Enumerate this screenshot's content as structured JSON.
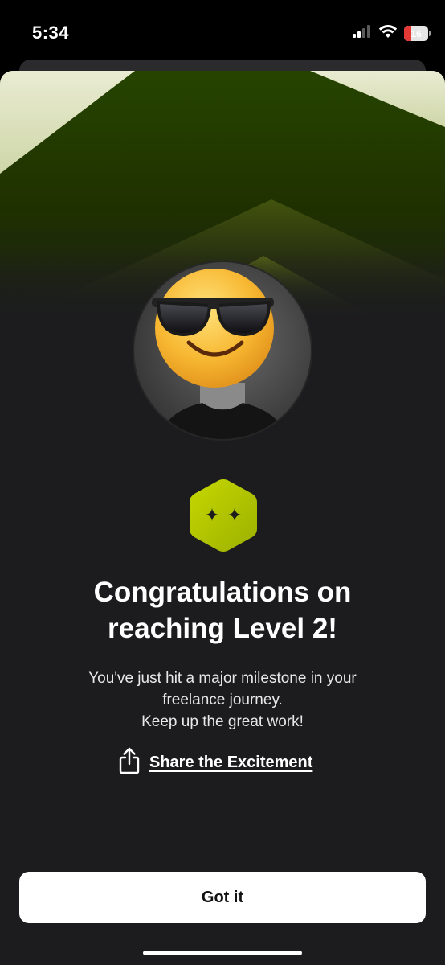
{
  "status_bar": {
    "time": "5:34",
    "battery_label": "16",
    "battery_level": 0.16,
    "icons": [
      "cellular-signal-icon",
      "wifi-icon",
      "battery-charging-icon"
    ]
  },
  "modal": {
    "avatar_icon": "profile-avatar-sunglasses-emoji",
    "badge_icon": "level-hexagon-badge-icon",
    "title_lines": [
      "Congratulations on",
      "reaching Level 2!"
    ],
    "description_lines": [
      "You've just hit a major milestone in your",
      "freelance journey.",
      "Keep up the great work!"
    ],
    "share_icon": "share-icon",
    "share_label": "Share the Excitement",
    "primary_button": "Got it"
  },
  "colors": {
    "sheet_background": "#1c1c1e",
    "hero_green": "#264400",
    "badge_lime": "#b6cc00",
    "button_background": "#ffffff",
    "battery_low": "#e53935"
  }
}
